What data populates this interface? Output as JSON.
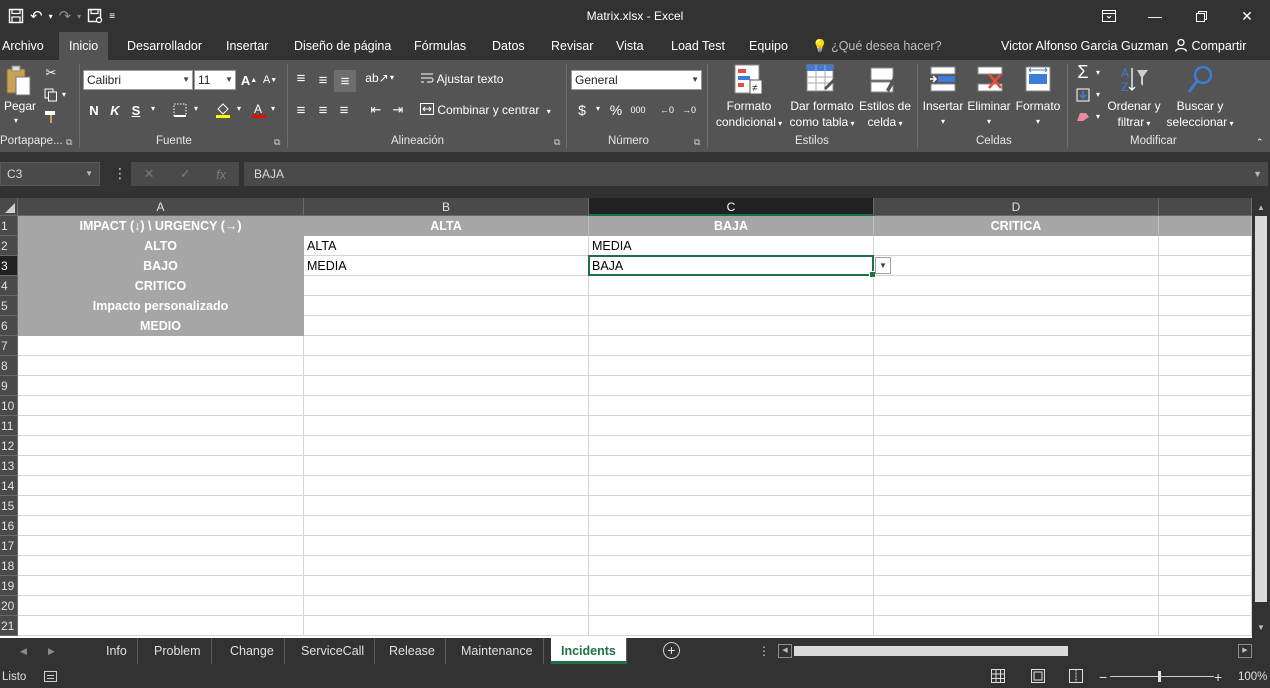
{
  "app": {
    "doc_title": "Matrix.xlsx  -  Excel"
  },
  "tabs": {
    "file": "Archivo",
    "home": "Inicio",
    "developer": "Desarrollador",
    "insert": "Insertar",
    "page_layout": "Diseño de página",
    "formulas": "Fórmulas",
    "data": "Datos",
    "review": "Revisar",
    "view": "Vista",
    "load_test": "Load Test",
    "team": "Equipo",
    "tell_me": "¿Qué desea hacer?",
    "user_name": "Victor Alfonso Garcia Guzman",
    "share": "Compartir"
  },
  "ribbon": {
    "clipboard": {
      "paste": "Pegar",
      "label": "Portapape..."
    },
    "font": {
      "name": "Calibri",
      "size": "11",
      "bold": "N",
      "italic": "K",
      "underline": "S",
      "label": "Fuente"
    },
    "alignment": {
      "wrap_text": "Ajustar texto",
      "merge_center": "Combinar y centrar",
      "label": "Alineación"
    },
    "number": {
      "format": "General",
      "currency": "$",
      "percent": "%",
      "thousands": "000",
      "label": "Número"
    },
    "styles": {
      "conditional_1": "Formato",
      "conditional_2": "condicional",
      "format_table_1": "Dar formato",
      "format_table_2": "como tabla",
      "cell_styles_1": "Estilos de",
      "cell_styles_2": "celda",
      "label": "Estilos"
    },
    "cells": {
      "insert": "Insertar",
      "delete": "Eliminar",
      "format": "Formato",
      "label": "Celdas"
    },
    "editing": {
      "sort_1": "Ordenar y",
      "sort_2": "filtrar",
      "find_1": "Buscar y",
      "find_2": "seleccionar",
      "label": "Modificar"
    }
  },
  "formula_bar": {
    "name_box": "C3",
    "cancel": "✕",
    "enter": "✓",
    "fx": "fx",
    "value": "BAJA"
  },
  "grid": {
    "columns": [
      "A",
      "B",
      "C",
      "D"
    ],
    "rows": [
      "1",
      "2",
      "3",
      "4",
      "5",
      "6",
      "7",
      "8",
      "9",
      "10",
      "11",
      "12",
      "13",
      "14",
      "15",
      "16",
      "17",
      "18",
      "19",
      "20",
      "21"
    ],
    "cells": {
      "A1": "IMPACT (↓) \\ URGENCY (→)",
      "B1": "ALTA",
      "C1": "BAJA",
      "D1": "CRITICA",
      "A2": "ALTO",
      "A3": "BAJO",
      "A4": "CRITICO",
      "A5": "Impacto personalizado",
      "A6": "MEDIO",
      "B2": "ALTA",
      "C2": "MEDIA",
      "B3": "MEDIA",
      "C3": "BAJA"
    },
    "active_cell": "C3"
  },
  "sheets": {
    "tabs": [
      "Info",
      "Problem",
      "Change",
      "ServiceCall",
      "Release",
      "Maintenance",
      "Incidents"
    ],
    "active": "Incidents"
  },
  "status": {
    "ready": "Listo",
    "zoom": "100%"
  },
  "colors": {
    "accent": "#1e7145",
    "ribbon_bg": "#545454",
    "titlebar_bg": "#323232",
    "header_fill": "#a6a6a6"
  }
}
